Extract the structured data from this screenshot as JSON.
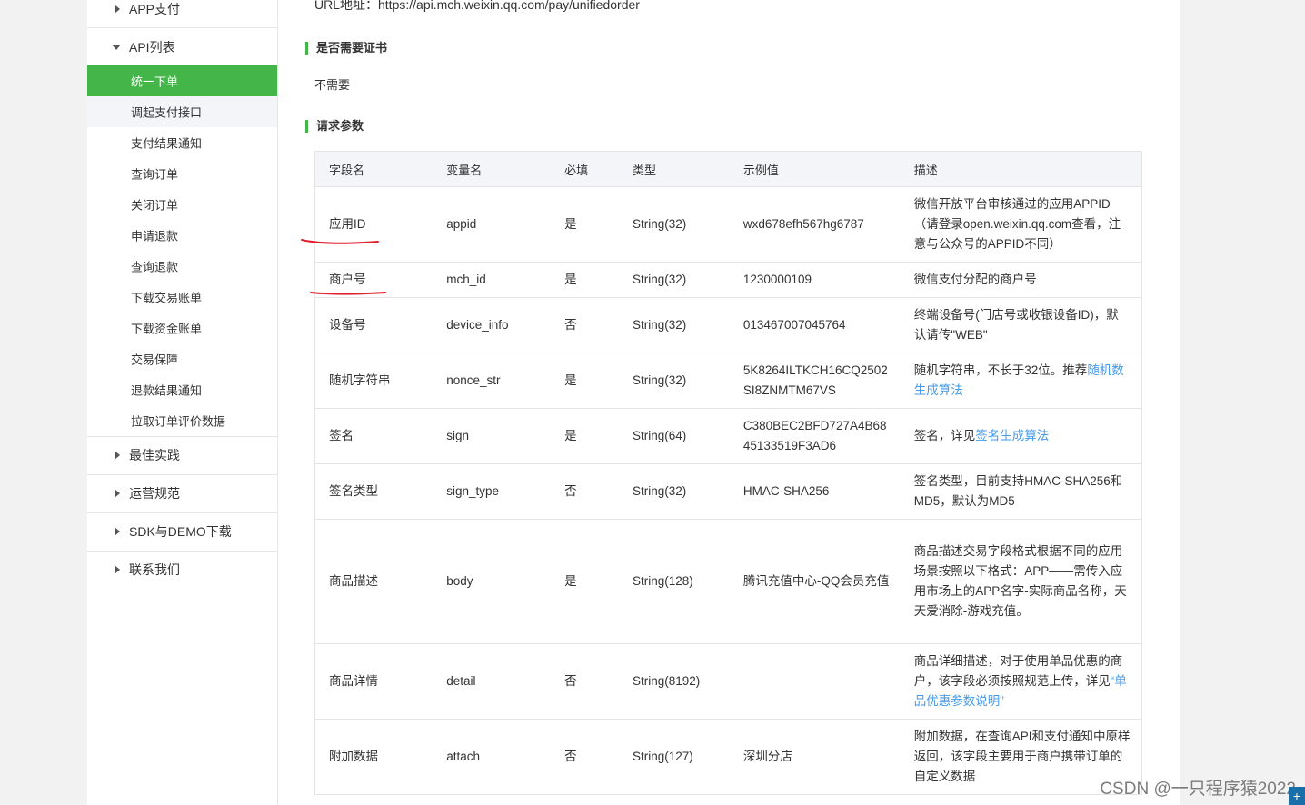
{
  "sidebar": {
    "groups_top": [
      {
        "label": "APP支付",
        "expanded": false
      },
      {
        "label": "API列表",
        "expanded": true
      }
    ],
    "items": [
      {
        "label": "统一下单",
        "state": "active"
      },
      {
        "label": "调起支付接口",
        "state": "hover"
      },
      {
        "label": "支付结果通知",
        "state": ""
      },
      {
        "label": "查询订单",
        "state": ""
      },
      {
        "label": "关闭订单",
        "state": ""
      },
      {
        "label": "申请退款",
        "state": ""
      },
      {
        "label": "查询退款",
        "state": ""
      },
      {
        "label": "下载交易账单",
        "state": ""
      },
      {
        "label": "下载资金账单",
        "state": ""
      },
      {
        "label": "交易保障",
        "state": ""
      },
      {
        "label": "退款结果通知",
        "state": ""
      },
      {
        "label": "拉取订单评价数据",
        "state": ""
      }
    ],
    "groups_bottom": [
      {
        "label": "最佳实践"
      },
      {
        "label": "运营规范"
      },
      {
        "label": "SDK与DEMO下载"
      },
      {
        "label": "联系我们"
      }
    ]
  },
  "main": {
    "url_line": "URL地址：https://api.mch.weixin.qq.com/pay/unifiedorder",
    "cert_title": "是否需要证书",
    "cert_value": "不需要",
    "params_title": "请求参数",
    "table": {
      "headers": [
        "字段名",
        "变量名",
        "必填",
        "类型",
        "示例值",
        "描述"
      ],
      "rows": [
        {
          "name": "应用ID",
          "var": "appid",
          "req": "是",
          "type": "String(32)",
          "example": "wxd678efh567hg6787",
          "desc": "微信开放平台审核通过的应用APPID（请登录open.weixin.qq.com查看，注意与公众号的APPID不同）",
          "desc_link": ""
        },
        {
          "name": "商户号",
          "var": "mch_id",
          "req": "是",
          "type": "String(32)",
          "example": "1230000109",
          "desc": "微信支付分配的商户号",
          "desc_link": ""
        },
        {
          "name": "设备号",
          "var": "device_info",
          "req": "否",
          "type": "String(32)",
          "example": "013467007045764",
          "desc": "终端设备号(门店号或收银设备ID)，默认请传\"WEB\"",
          "desc_link": ""
        },
        {
          "name": "随机字符串",
          "var": "nonce_str",
          "req": "是",
          "type": "String(32)",
          "example": "5K8264ILTKCH16CQ2502SI8ZNMTM67VS",
          "desc": "随机字符串，不长于32位。推荐",
          "desc_link": "随机数生成算法"
        },
        {
          "name": "签名",
          "var": "sign",
          "req": "是",
          "type": "String(64)",
          "example": "C380BEC2BFD727A4B6845133519F3AD6",
          "desc": "签名，详见",
          "desc_link": "签名生成算法"
        },
        {
          "name": "签名类型",
          "var": "sign_type",
          "req": "否",
          "type": "String(32)",
          "example": "HMAC-SHA256",
          "desc": "签名类型，目前支持HMAC-SHA256和MD5，默认为MD5",
          "desc_link": ""
        },
        {
          "name": "商品描述",
          "var": "body",
          "req": "是",
          "type": "String(128)",
          "example": "腾讯充值中心-QQ会员充值",
          "desc": "商品描述交易字段格式根据不同的应用场景按照以下格式：APP——需传入应用市场上的APP名字-实际商品名称，天天爱消除-游戏充值。",
          "desc_link": ""
        },
        {
          "name": "商品详情",
          "var": "detail",
          "req": "否",
          "type": "String(8192)",
          "example": "",
          "desc": "商品详细描述，对于使用单品优惠的商户，该字段必须按照规范上传，详见",
          "desc_link": "“单品优惠参数说明”"
        },
        {
          "name": "附加数据",
          "var": "attach",
          "req": "否",
          "type": "String(127)",
          "example": "深圳分店",
          "desc": "附加数据，在查询API和支付通知中原样返回，该字段主要用于商户携带订单的自定义数据",
          "desc_link": ""
        }
      ]
    }
  },
  "watermark": "CSDN @一只程序猿2022",
  "colors": {
    "accent": "#44b549",
    "link": "#459ae9",
    "annotation": "#e0202e"
  }
}
